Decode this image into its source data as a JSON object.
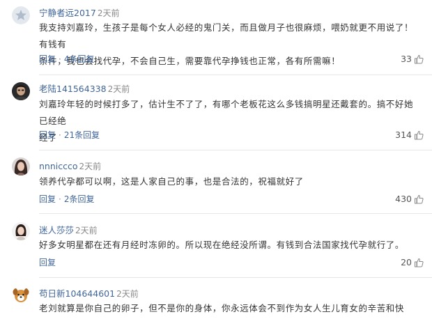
{
  "comments": [
    {
      "username": "宁静者远2017",
      "time": "2天前",
      "text_lines": [
        "我支持刘嘉玲，生孩子是每个女人必经的鬼门关，而且做月子也很麻烦，喂奶就更不用说了！有钱有",
        "条件，我也会找代孕，不会自己生，需要靠代孕挣钱也正常，各有所需嘛！"
      ],
      "reply_label": "回复",
      "replies_label": "4条回复",
      "likes": "33",
      "avatar_icon": "star-avatar-icon"
    },
    {
      "username": "老陆141564338",
      "time": "2天前",
      "text_lines": [
        "刘嘉玲年轻的时候打多了，估计生不了了，有哪个老板花这么多钱搞明星还戴套的。搞不好她已经绝",
        "经了"
      ],
      "reply_label": "回复",
      "replies_label": "21条回复",
      "likes": "314",
      "avatar_icon": "man-photo-avatar-icon"
    },
    {
      "username": "nnniccco",
      "time": "2天前",
      "text_lines": [
        "领养代孕都可以啊，这是人家自己的事，也是合法的，祝福就好了"
      ],
      "reply_label": "回复",
      "replies_label": "2条回复",
      "likes": "430",
      "avatar_icon": "woman-photo-avatar-icon"
    },
    {
      "username": "迷人莎莎",
      "time": "2天前",
      "text_lines": [
        "好多女明星都在还有月经时冻卵的。所以现在绝经没所谓。有钱到合法国家找代孕就行了。"
      ],
      "reply_label": "回复",
      "replies_label": "",
      "likes": "20",
      "avatar_icon": "girl-photo-avatar-icon"
    },
    {
      "username": "苟日新104644601",
      "time": "2天前",
      "text_lines": [
        "老刘就算是你自己的卵子，但不是你的身体，你永远体会不到作为女人生儿育女的辛苦和快乐，悲哀"
      ],
      "reply_label": "",
      "replies_label": "",
      "likes": "",
      "avatar_icon": "dog-avatar-icon"
    }
  ],
  "colors": {
    "link": "#406599",
    "meta": "#888888",
    "text": "#333333",
    "divider": "#e6e6e6"
  }
}
